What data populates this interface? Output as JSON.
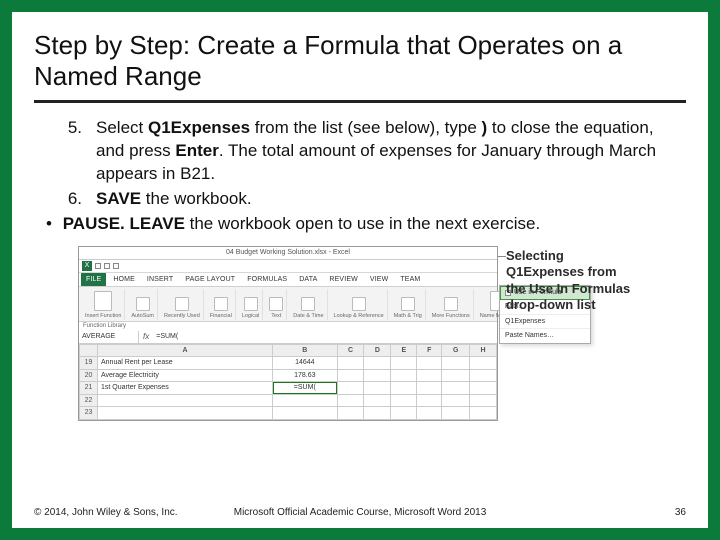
{
  "title": "Step by Step: Create a Formula that Operates on a Named Range",
  "steps": [
    {
      "num": "5.",
      "parts": [
        "Select ",
        "Q1Expenses",
        " from the list (see below), type ",
        ")",
        " to close the equation, and press ",
        "Enter",
        ". The total amount of expenses for January through March appears in B21."
      ]
    },
    {
      "num": "6.",
      "parts": [
        "",
        "SAVE",
        " the workbook."
      ]
    }
  ],
  "bullets": [
    {
      "parts": [
        "",
        "PAUSE. LEAVE",
        " the workbook open to use in the next exercise."
      ]
    }
  ],
  "excel": {
    "titlebar": "04 Budget Working Solution.xlsx - Excel",
    "xl": "X",
    "tabs": [
      "FILE",
      "HOME",
      "INSERT",
      "PAGE LAYOUT",
      "FORMULAS",
      "DATA",
      "REVIEW",
      "VIEW",
      "Team"
    ],
    "groups": [
      {
        "label": "Insert Function"
      },
      {
        "label": "AutoSum"
      },
      {
        "label": "Recently Used"
      },
      {
        "label": "Financial"
      },
      {
        "label": "Logical"
      },
      {
        "label": "Text"
      },
      {
        "label": "Date & Time"
      },
      {
        "label": "Lookup & Reference"
      },
      {
        "label": "Math & Trig"
      },
      {
        "label": "More Functions"
      },
      {
        "label": "Name Manager"
      }
    ],
    "fnlib": "Function Library",
    "popup": [
      "Use in Formula",
      "Fabi…",
      "Q1Expenses",
      "Paste Names…"
    ],
    "namebox": "AVERAGE",
    "fx": "fx",
    "formula": "=SUM(",
    "cols": [
      "",
      "A",
      "B",
      "C",
      "D",
      "E",
      "F",
      "G",
      "H"
    ],
    "rows": [
      {
        "n": "19",
        "a": "Annual Rent per Lease",
        "b": "14644"
      },
      {
        "n": "20",
        "a": "Average Electricity",
        "b": "178.63"
      },
      {
        "n": "21",
        "a": "1st Quarter Expenses",
        "b": "=SUM("
      },
      {
        "n": "22",
        "a": "",
        "b": ""
      },
      {
        "n": "23",
        "a": "",
        "b": ""
      }
    ]
  },
  "callout": "Selecting Q1Expenses from the Use In Formulas drop-down list",
  "footer": {
    "left": "© 2014, John Wiley & Sons, Inc.",
    "mid": "Microsoft Official Academic Course, Microsoft Word 2013",
    "right": "36"
  }
}
